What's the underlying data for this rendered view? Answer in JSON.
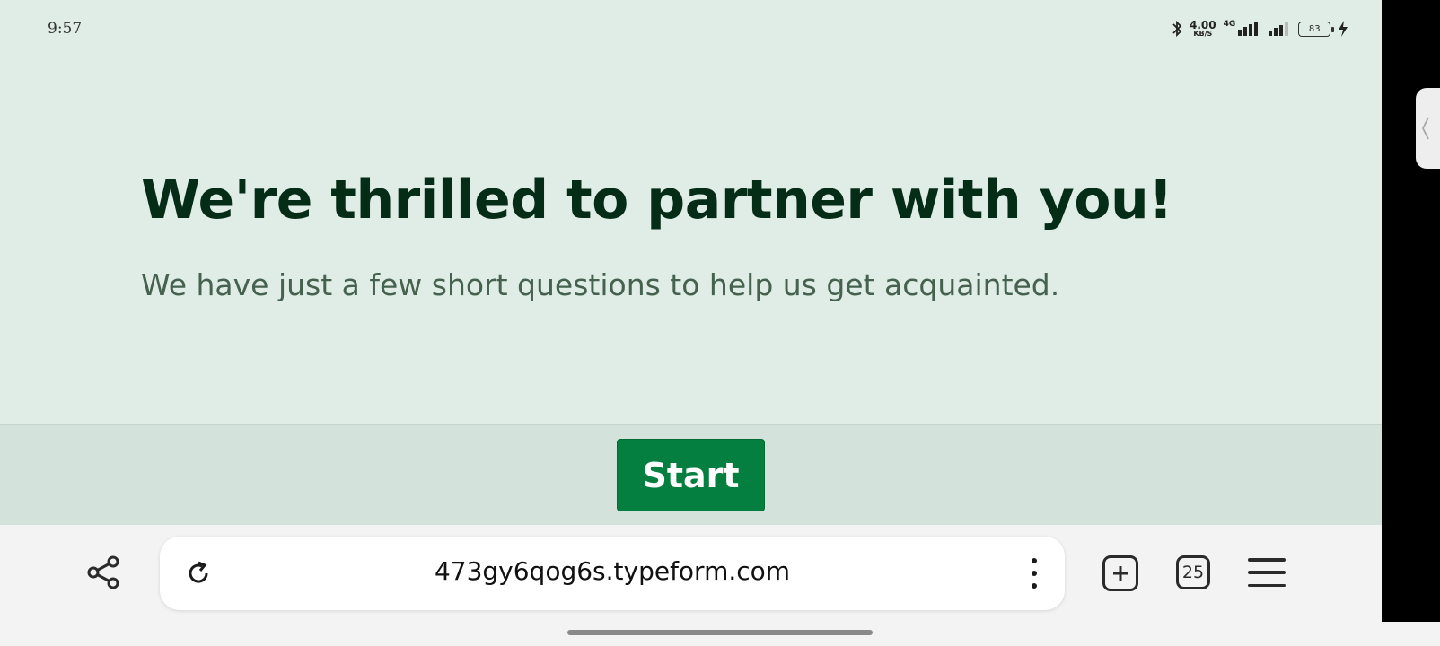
{
  "status_bar": {
    "time": "9:57",
    "net_speed_value": "4.00",
    "net_speed_unit": "KB/S",
    "network_label": "4G",
    "battery_level": "83"
  },
  "page": {
    "headline": "We're thrilled to partner with you!",
    "subtitle": "We have just a few short questions to help us get acquainted.",
    "start_label": "Start",
    "colors": {
      "background": "#dfede6",
      "footer_band": "#d3e2db",
      "headline": "#052c16",
      "button": "#047f3f"
    }
  },
  "browser": {
    "url": "473gy6qog6s.typeform.com",
    "tab_count": "25",
    "icons": [
      "share-icon",
      "reload-icon",
      "more-vertical-icon",
      "new-tab-icon",
      "tabs-icon",
      "menu-icon"
    ]
  }
}
